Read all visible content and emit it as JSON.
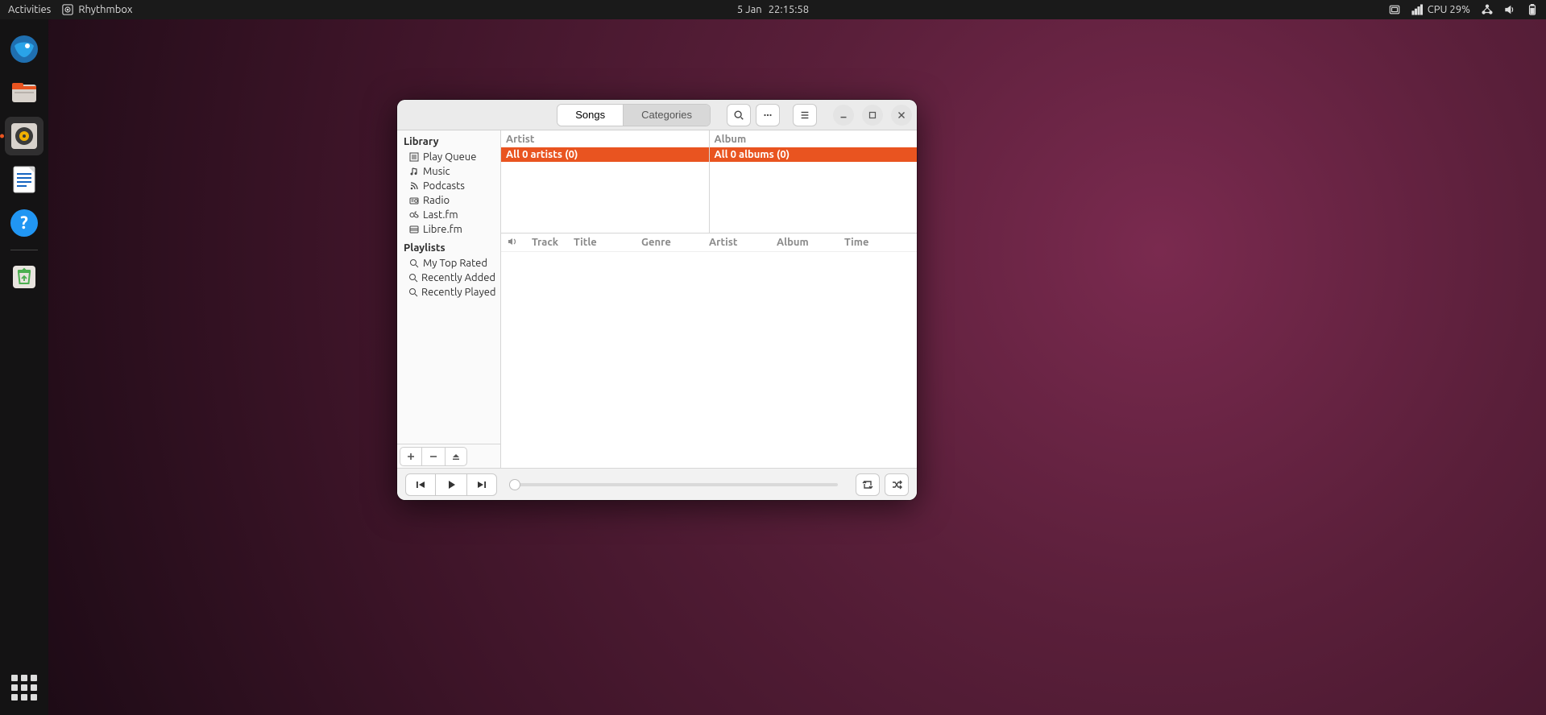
{
  "topbar": {
    "activities": "Activities",
    "app_name": "Rhythmbox",
    "date": "5 Jan",
    "time": "22:15:58",
    "cpu": "CPU 29%"
  },
  "dock": {
    "items": [
      {
        "name": "thunderbird-icon"
      },
      {
        "name": "files-icon"
      },
      {
        "name": "rhythmbox-icon"
      },
      {
        "name": "libreoffice-writer-icon"
      },
      {
        "name": "help-icon"
      },
      {
        "name": "trash-icon"
      }
    ]
  },
  "window": {
    "tabs": {
      "songs": "Songs",
      "categories": "Categories"
    },
    "sidebar": {
      "library_header": "Library",
      "library": [
        {
          "label": "Play Queue"
        },
        {
          "label": "Music"
        },
        {
          "label": "Podcasts"
        },
        {
          "label": "Radio"
        },
        {
          "label": "Last.fm"
        },
        {
          "label": "Libre.fm"
        }
      ],
      "playlists_header": "Playlists",
      "playlists": [
        {
          "label": "My Top Rated"
        },
        {
          "label": "Recently Added"
        },
        {
          "label": "Recently Played"
        }
      ]
    },
    "browsers": {
      "artist_header": "Artist",
      "album_header": "Album",
      "artist_all": "All 0 artists (0)",
      "album_all": "All 0 albums (0)"
    },
    "columns": {
      "track": "Track",
      "title": "Title",
      "genre": "Genre",
      "artist": "Artist",
      "album": "Album",
      "time": "Time"
    }
  }
}
